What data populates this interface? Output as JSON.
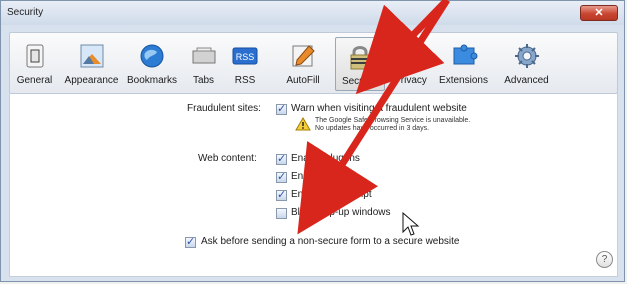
{
  "window": {
    "title": "Security",
    "close_icon": "close-icon",
    "close_glyph": "✕"
  },
  "toolbar": {
    "items": [
      {
        "label": "General",
        "icon": "general-switch-icon"
      },
      {
        "label": "Appearance",
        "icon": "appearance-icon"
      },
      {
        "label": "Bookmarks",
        "icon": "globe-icon"
      },
      {
        "label": "Tabs",
        "icon": "tabs-icon"
      },
      {
        "label": "RSS",
        "icon": "rss-icon"
      },
      {
        "label": "AutoFill",
        "icon": "autofill-pencil-icon"
      },
      {
        "label": "Security",
        "icon": "lock-icon",
        "selected": true
      },
      {
        "label": "Privacy",
        "icon": "privacy-person-icon"
      },
      {
        "label": "Extensions",
        "icon": "extensions-puzzle-icon"
      },
      {
        "label": "Advanced",
        "icon": "gear-icon"
      }
    ],
    "rss_badge": "RSS"
  },
  "security": {
    "fraudulent_label": "Fraudulent sites:",
    "fraudulent_checkbox": {
      "label": "Warn when visiting a fraudulent website",
      "checked": true
    },
    "warning_line1": "The Google Safe Browsing Service is unavailable.",
    "warning_line2": "No updates have occurred in 3 days.",
    "web_content_label": "Web content:",
    "web_content_options": [
      {
        "label": "Enable plug-ins",
        "checked": true
      },
      {
        "label": "Enable Java",
        "checked": true
      },
      {
        "label": "Enable JavaScript",
        "checked": true
      },
      {
        "label": "Block pop-up windows",
        "checked": false
      }
    ],
    "ask_checkbox": {
      "label": "Ask before sending a non-secure form to a secure website",
      "checked": true
    },
    "help_label": "?"
  },
  "annotation": {
    "arrow_color": "#d9261c"
  }
}
